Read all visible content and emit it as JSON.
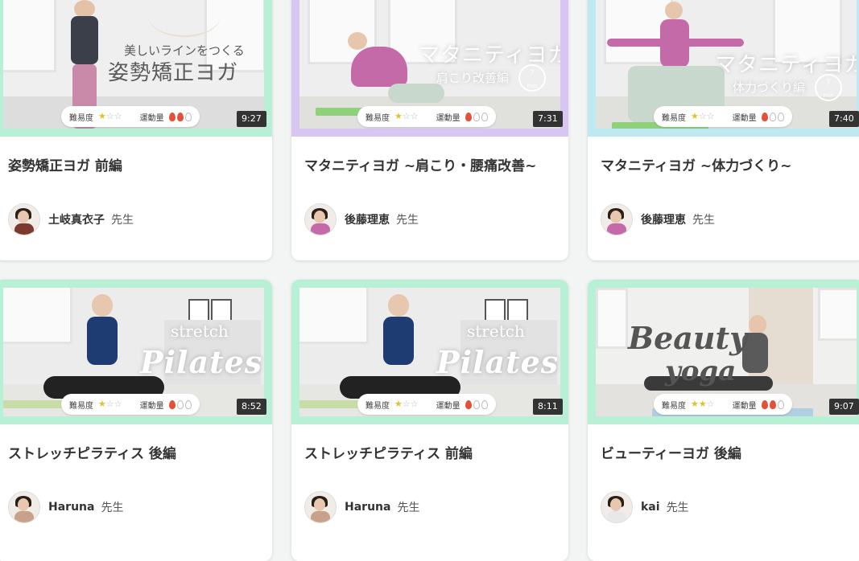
{
  "labels": {
    "difficulty": "難易度",
    "exercise": "運動量",
    "teacher_suffix": "先生",
    "min": "min"
  },
  "cards": [
    {
      "title": "姿勢矯正ヨガ 前編",
      "duration": "9:27",
      "difficulty": 1,
      "exercise": 2,
      "author": "土岐真衣子",
      "overlay": {
        "line1": "美しいラインをつくる",
        "line2": "姿勢矯正ヨガ"
      },
      "border_color": "#b8f0d6",
      "avatar_outfit": "#7a3b2e"
    },
    {
      "title": "マタニティヨガ ~肩こり・腰痛改善~",
      "duration": "7:31",
      "difficulty": 1,
      "exercise": 1,
      "author": "後藤理恵",
      "overlay": {
        "line1": "マタニティヨガ",
        "line2": "肩こり改善編",
        "min_num": "7"
      },
      "border_color": "#d8c6f2",
      "avatar_outfit": "#c46aa8"
    },
    {
      "title": "マタニティヨガ ~体力づくり~",
      "duration": "7:40",
      "difficulty": 1,
      "exercise": 1,
      "author": "後藤理恵",
      "overlay": {
        "line1": "マタニティヨガ",
        "line2": "体力づくり編",
        "min_num": "7"
      },
      "border_color": "#bfe9f0",
      "avatar_outfit": "#c46aa8"
    },
    {
      "title": "ストレッチピラティス 後編",
      "duration": "8:52",
      "difficulty": 1,
      "exercise": 1,
      "author": "Haruna",
      "overlay": {
        "line1": "stretch",
        "line2": "Pilates"
      },
      "border_color": "#b8f0d6",
      "avatar_outfit": "#c9a08a"
    },
    {
      "title": "ストレッチピラティス 前編",
      "duration": "8:11",
      "difficulty": 1,
      "exercise": 1,
      "author": "Haruna",
      "overlay": {
        "line1": "stretch",
        "line2": "Pilates"
      },
      "border_color": "#b8f0d6",
      "avatar_outfit": "#c9a08a"
    },
    {
      "title": "ビューティーヨガ 後編",
      "duration": "9:07",
      "difficulty": 2,
      "exercise": 2,
      "author": "kai",
      "overlay": {
        "line1": "Beauty",
        "line2": "yoga"
      },
      "border_color": "#b8f0d6",
      "avatar_outfit": "#e8e8e8"
    }
  ]
}
